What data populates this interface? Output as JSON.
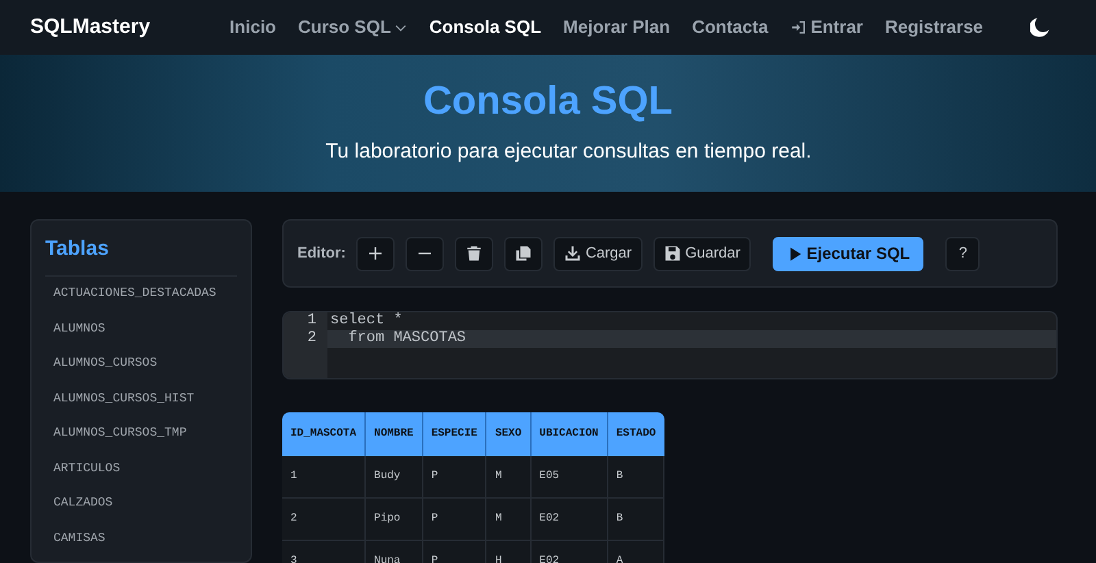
{
  "navbar": {
    "brand": "SQLMastery",
    "items": [
      {
        "label": "Inicio",
        "selected": false,
        "kind": "link"
      },
      {
        "label": "Curso SQL",
        "selected": false,
        "kind": "dropdown"
      },
      {
        "label": "Consola SQL",
        "selected": true,
        "kind": "link"
      },
      {
        "label": "Mejorar Plan",
        "selected": false,
        "kind": "link"
      },
      {
        "label": "Contacta",
        "selected": false,
        "kind": "link"
      },
      {
        "label": "Entrar",
        "selected": false,
        "kind": "login"
      },
      {
        "label": "Registrarse",
        "selected": false,
        "kind": "link"
      }
    ]
  },
  "hero": {
    "title": "Consola SQL",
    "subtitle": "Tu laboratorio para ejecutar consultas en tiempo real."
  },
  "sidebar": {
    "title": "Tablas",
    "items": [
      "ACTUACIONES_DESTACADAS",
      "ALUMNOS",
      "ALUMNOS_CURSOS",
      "ALUMNOS_CURSOS_HIST",
      "ALUMNOS_CURSOS_TMP",
      "ARTICULOS",
      "CALZADOS",
      "CAMISAS"
    ]
  },
  "toolbar": {
    "label": "Editor:",
    "buttons": [
      {
        "kind": "plus"
      },
      {
        "kind": "minus"
      },
      {
        "kind": "trash"
      },
      {
        "kind": "copy"
      },
      {
        "kind": "load",
        "label": "Cargar"
      },
      {
        "kind": "save",
        "label": "Guardar"
      },
      {
        "kind": "run",
        "label": "Ejecutar SQL"
      },
      {
        "kind": "help",
        "label": "?"
      }
    ]
  },
  "editor": {
    "lines": [
      {
        "number": "1",
        "text": "select *",
        "active": false
      },
      {
        "number": "2",
        "text": "  from MASCOTAS",
        "active": true
      }
    ]
  },
  "results": {
    "columns": [
      "ID_MASCOTA",
      "NOMBRE",
      "ESPECIE",
      "SEXO",
      "UBICACION",
      "ESTADO"
    ],
    "rows": [
      [
        "1",
        "Budy",
        "P",
        "M",
        "E05",
        "B"
      ],
      [
        "2",
        "Pipo",
        "P",
        "M",
        "E02",
        "B"
      ],
      [
        "3",
        "Nuna",
        "P",
        "H",
        "E02",
        "A"
      ]
    ]
  }
}
